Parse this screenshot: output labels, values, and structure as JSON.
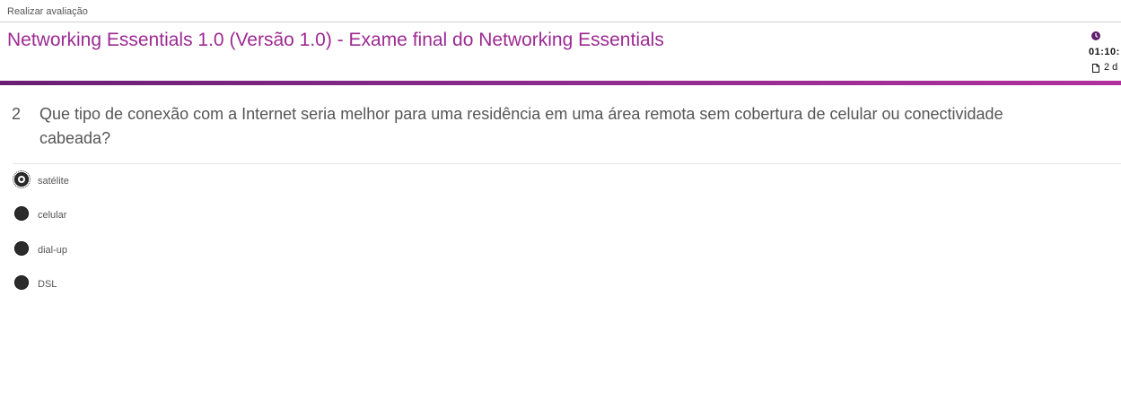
{
  "header": {
    "breadcrumb": "Realizar avaliação",
    "title": "Networking Essentials 1.0 (Versão 1.0) - Exame final do Networking Essentials",
    "timer": "01:10:",
    "question_count": "2 d",
    "accent_color": "#9c2a92"
  },
  "question": {
    "number": "2",
    "text": "Que tipo de conexão com a Internet seria melhor para uma residência em uma área remota sem cobertura de celular ou conectividade cabeada?",
    "options": [
      {
        "label": "satélite",
        "selected": true
      },
      {
        "label": "celular",
        "selected": false
      },
      {
        "label": "dial-up",
        "selected": false
      },
      {
        "label": "DSL",
        "selected": false
      }
    ]
  },
  "icons": {
    "timer": "clock-icon",
    "question_count": "document-icon"
  }
}
